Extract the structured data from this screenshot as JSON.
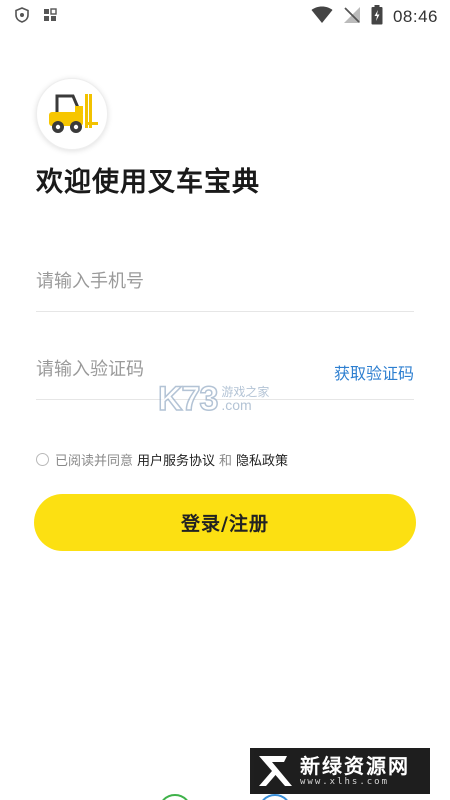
{
  "status_bar": {
    "time": "08:46",
    "left_icons": [
      "shield-icon",
      "grid-icon"
    ],
    "right_icons": [
      "wifi-icon",
      "no-signal-icon",
      "battery-charging-icon"
    ]
  },
  "app": {
    "welcome_title": "欢迎使用叉车宝典",
    "brand_color": "#fce012"
  },
  "form": {
    "phone_placeholder": "请输入手机号",
    "phone_value": "",
    "code_placeholder": "请输入验证码",
    "code_value": "",
    "get_code_label": "获取验证码",
    "link_color": "#2e7fd0"
  },
  "agreement": {
    "prefix": "已阅读并同意",
    "user_agreement": "用户服务协议",
    "conjunction": "和",
    "privacy_policy": "隐私政策"
  },
  "login_button": {
    "label": "登录/注册"
  },
  "watermarks": {
    "center_logo": "K73",
    "center_cn": "游戏之家",
    "center_com": ".com",
    "bottom_cn": "新绿资源网",
    "bottom_url": "www.xlhs.com"
  }
}
